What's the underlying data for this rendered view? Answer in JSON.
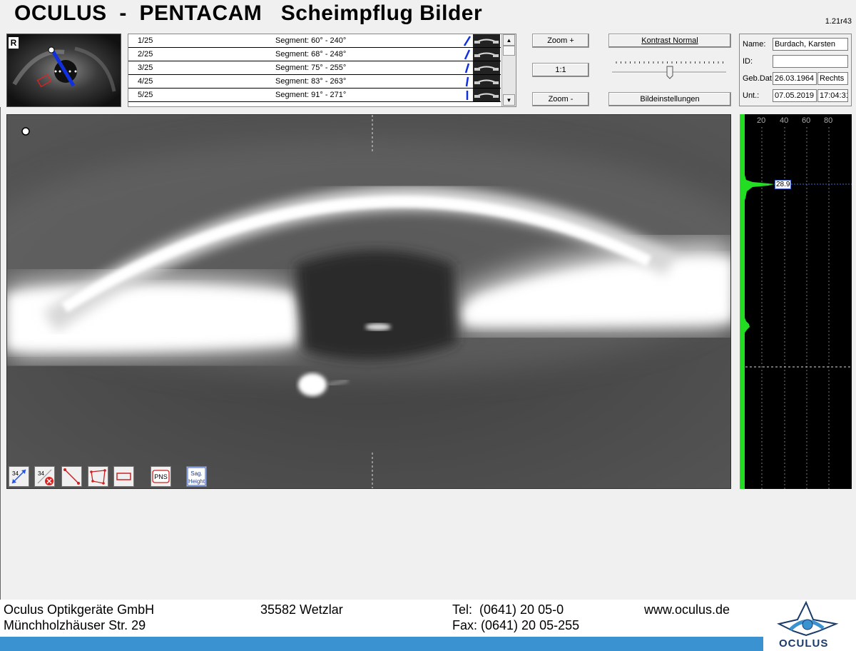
{
  "header": {
    "title": "OCULUS  -  PENTACAM   Scheimpflug Bilder",
    "version": "1.21r43"
  },
  "thumbnail": {
    "eye_badge": "R",
    "angle_label": "60"
  },
  "image_list": [
    {
      "num": "1/25",
      "segment": "Segment: 60° - 240°"
    },
    {
      "num": "2/25",
      "segment": "Segment: 68° - 248°"
    },
    {
      "num": "3/25",
      "segment": "Segment: 75° - 255°"
    },
    {
      "num": "4/25",
      "segment": "Segment: 83° - 263°"
    },
    {
      "num": "5/25",
      "segment": "Segment: 91° - 271°"
    }
  ],
  "scrollbar": {
    "up": "▲",
    "down": "▼"
  },
  "zoom": {
    "zoom_in": "Zoom +",
    "one_to_one": "1:1",
    "zoom_out": "Zoom -"
  },
  "contrast": {
    "normal_label": "Kontrast Normal",
    "settings_label": "Bildeinstellungen",
    "slider_level": 0.5
  },
  "patient": {
    "name_label": "Name:",
    "name_value": "Burdach, Karsten",
    "id_label": "ID:",
    "id_value": "",
    "dob_label": "Geb.Dat.",
    "dob_value": "26.03.1964",
    "eye_value": "Rechts",
    "exam_label": "Unt.:",
    "exam_date": "07.05.2019",
    "exam_time": "17:04:31"
  },
  "tools": {
    "pns_label": "PNS",
    "sag_label_1": "Sag.",
    "sag_label_2": "Height",
    "dist_label": "34"
  },
  "histogram": {
    "ticks": [
      "20",
      "40",
      "60",
      "80"
    ],
    "marker_value": "28.9",
    "color": "#22dd22"
  },
  "footer": {
    "company": "Oculus Optikgeräte GmbH",
    "street": "Münchholzhäuser Str. 29",
    "city": "35582 Wetzlar",
    "tel": "Tel:  (0641) 20 05-0",
    "fax": "Fax: (0641) 20 05-255",
    "web": "www.oculus.de",
    "logo": "OCULUS",
    "accent": "#3a92d0"
  }
}
